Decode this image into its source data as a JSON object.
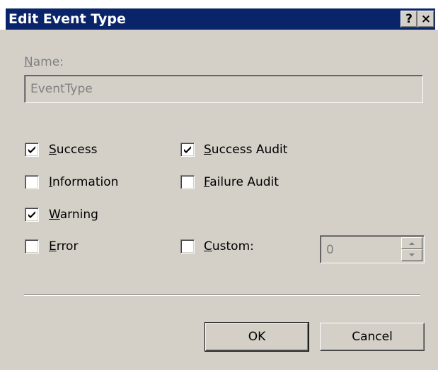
{
  "window": {
    "title": "Edit Event Type",
    "help_button": "?",
    "close_button": "×"
  },
  "name_field": {
    "label_mnemonic": "N",
    "label_rest": "ame:",
    "value": "EventType"
  },
  "checkboxes": {
    "success": {
      "mnemonic": "S",
      "rest": "uccess",
      "checked": true
    },
    "information": {
      "mnemonic": "I",
      "rest": "nformation",
      "checked": false
    },
    "warning": {
      "mnemonic": "W",
      "rest": "arning",
      "checked": true
    },
    "error": {
      "mnemonic": "E",
      "rest": "rror",
      "checked": false
    },
    "success_audit": {
      "mnemonic": "S",
      "rest": "uccess Audit",
      "checked": true
    },
    "failure_audit": {
      "mnemonic": "F",
      "rest": "ailure Audit",
      "checked": false
    },
    "custom": {
      "mnemonic": "C",
      "rest": "ustom:",
      "checked": false
    }
  },
  "custom_value": "0",
  "buttons": {
    "ok": "OK",
    "cancel": "Cancel"
  }
}
